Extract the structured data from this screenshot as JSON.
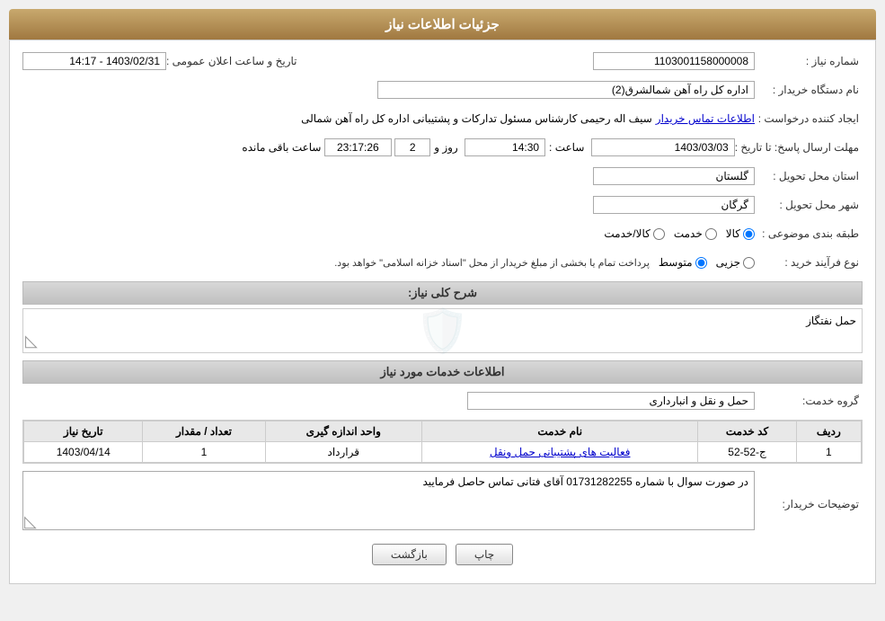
{
  "header": {
    "title": "جزئیات اطلاعات نیاز"
  },
  "fields": {
    "shomara_niaz_label": "شماره نیاز :",
    "shomara_niaz_value": "1103001158000008",
    "nam_dastgah_label": "نام دستگاه خریدار :",
    "nam_dastgah_value": "اداره کل راه آهن شمالشرق(2)",
    "ijad_konande_label": "ایجاد کننده درخواست :",
    "ijad_konande_value": "سیف اله رحیمی کارشناس مسئول تدارکات و پشتیبانی اداره کل راه آهن شمالی",
    "ijad_konande_link": "اطلاعات تماس خریدار",
    "mohlat_label": "مهلت ارسال پاسخ: تا تاریخ :",
    "mohlat_date": "1403/03/03",
    "mohlat_saat_label": "ساعت :",
    "mohlat_saat": "14:30",
    "mohlat_rooz_label": "روز و",
    "mohlat_rooz": "2",
    "mohlat_countdown_label": "ساعت باقی مانده",
    "mohlat_countdown": "23:17:26",
    "ostan_label": "استان محل تحویل :",
    "ostan_value": "گلستان",
    "shahr_label": "شهر محل تحویل :",
    "shahr_value": "گرگان",
    "taifebandi_label": "طبقه بندی موضوعی :",
    "taife_options": [
      "کالا",
      "خدمت",
      "کالا/خدمت"
    ],
    "taife_selected": "کالا",
    "nooe_farayand_label": "نوع فرآیند خرید :",
    "farayand_options": [
      "جزیی",
      "متوسط"
    ],
    "farayand_selected": "متوسط",
    "farayand_note": "پرداخت تمام یا بخشی از مبلغ خریدار از محل \"اسناد خزانه اسلامی\" خواهد بود.",
    "taarikh_ilan_label": "تاریخ و ساعت اعلان عمومی :",
    "taarikh_ilan_value": "1403/02/31 - 14:17",
    "sharh_koli_label": "شرح کلی نیاز:",
    "sharh_koli_value": "حمل نفتگاز",
    "khadamat_title": "اطلاعات خدمات مورد نیاز",
    "gorooh_khadamat_label": "گروه خدمت:",
    "gorooh_khadamat_value": "حمل و نقل و انبارداری",
    "table": {
      "headers": [
        "ردیف",
        "کد خدمت",
        "نام خدمت",
        "واحد اندازه گیری",
        "تعداد / مقدار",
        "تاریخ نیاز"
      ],
      "rows": [
        {
          "radif": "1",
          "kod_khadamat": "ج-52-52",
          "nam_khadamat": "فعالیت های پشتیبانی حمل ونقل",
          "vahed": "قرارداد",
          "tedad": "1",
          "tarikh": "1403/04/14"
        }
      ]
    },
    "tosif_kharidaar_label": "توضیحات خریدار:",
    "tosif_kharidaar_value": "در صورت سوال با شماره 01731282255 آقای فتانی تماس حاصل فرمایید"
  },
  "buttons": {
    "print": "چاپ",
    "back": "بازگشت"
  }
}
